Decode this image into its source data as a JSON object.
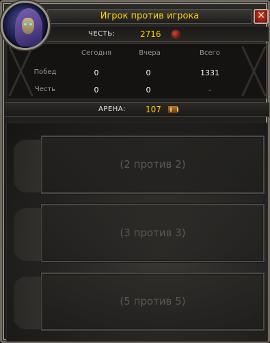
{
  "window": {
    "title": "Игрок против игрока",
    "close_label": "✕"
  },
  "honor": {
    "label": "ЧЕСТЬ:",
    "value": "2716"
  },
  "stats": {
    "columns": [
      "Сегодня",
      "Вчера",
      "Всего"
    ],
    "rows": [
      {
        "label": "Побед",
        "values": [
          "0",
          "0",
          "1331"
        ]
      },
      {
        "label": "Честь",
        "values": [
          "0",
          "0",
          "-"
        ]
      }
    ]
  },
  "arena": {
    "label": "АРЕНА:",
    "value": "107"
  },
  "teams": [
    {
      "label": "(2 против 2)"
    },
    {
      "label": "(3 против 3)"
    },
    {
      "label": "(5 против 5)"
    }
  ],
  "icons": {
    "portrait": "character-portrait",
    "honor": "honor-points-icon",
    "arena": "arena-points-icon",
    "close": "close-icon"
  },
  "colors": {
    "accent_gold": "#ffd200",
    "close_red": "#8a1a10"
  }
}
